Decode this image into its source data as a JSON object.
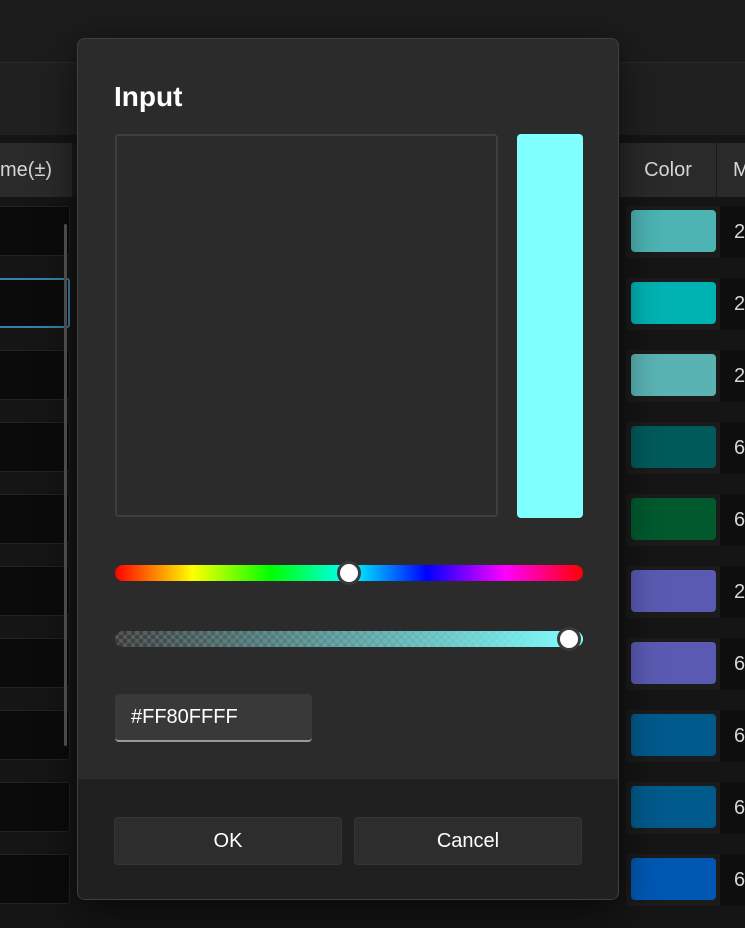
{
  "background_table": {
    "header": {
      "name_col": "me(±)",
      "color_col": "Color",
      "m_col": "M"
    },
    "rows": [
      {
        "color": "#4db3b3",
        "m": "2",
        "focused": false
      },
      {
        "color": "#00b3b3",
        "m": "2",
        "focused": true
      },
      {
        "color": "#5ab3b3",
        "m": "2",
        "focused": false
      },
      {
        "color": "#005a5a",
        "m": "6",
        "focused": false
      },
      {
        "color": "#005a2e",
        "m": "6",
        "focused": false
      },
      {
        "color": "#5a5ab3",
        "m": "2",
        "focused": false
      },
      {
        "color": "#5a5ab3",
        "m": "6",
        "focused": false
      },
      {
        "color": "#005a8c",
        "m": "6",
        "focused": false
      },
      {
        "color": "#005a8c",
        "m": "6",
        "focused": false
      },
      {
        "color": "#0058b3",
        "m": "6",
        "focused": false
      }
    ]
  },
  "dialog": {
    "title": "Input",
    "preview_color": "#80ffff",
    "hue_position": 0.5,
    "alpha_position": 0.97,
    "hex_value": "#FF80FFFF",
    "ok_label": "OK",
    "cancel_label": "Cancel"
  }
}
